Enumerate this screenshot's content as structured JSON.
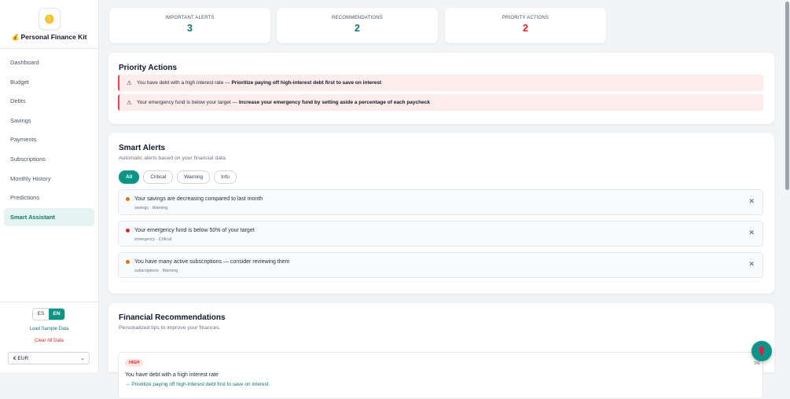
{
  "app": {
    "logo_icon": "🪙",
    "title_icon": "💰",
    "title": "Personal Finance Kit"
  },
  "nav": [
    {
      "label": "Dashboard",
      "active": false
    },
    {
      "label": "Budget",
      "active": false
    },
    {
      "label": "Debts",
      "active": false
    },
    {
      "label": "Savings",
      "active": false
    },
    {
      "label": "Payments",
      "active": false
    },
    {
      "label": "Subscriptions",
      "active": false
    },
    {
      "label": "Monthly History",
      "active": false
    },
    {
      "label": "Predictions",
      "active": false
    },
    {
      "label": "Smart Assistant",
      "active": true
    }
  ],
  "language": {
    "es": "ES",
    "en": "EN",
    "selected": "EN"
  },
  "sidebar_links": {
    "load_sample": "Load Sample Data",
    "clear_all": "Clear All Data"
  },
  "currency": {
    "selected": "€ EUR",
    "chevron": "⌄"
  },
  "stats": [
    {
      "label": "IMPORTANT ALERTS",
      "value": "3",
      "color": "#0f766e"
    },
    {
      "label": "RECOMMENDATIONS",
      "value": "2",
      "color": "#0f766e"
    },
    {
      "label": "PRIORITY ACTIONS",
      "value": "2",
      "color": "#dc2626"
    }
  ],
  "priority": {
    "title": "Priority Actions",
    "warn_icon": "⚠",
    "items": [
      {
        "text": "You have debt with a high interest rate — ",
        "action": "Prioritize paying off high-interest debt first to save on interest"
      },
      {
        "text": "Your emergency fund is below your target — ",
        "action": "Increase your emergency fund by setting aside a percentage of each paycheck"
      }
    ]
  },
  "alerts": {
    "title": "Smart Alerts",
    "subtitle": "Automatic alerts based on your financial data.",
    "filters": [
      "All",
      "Critical",
      "Warning",
      "Info"
    ],
    "active_filter": "All",
    "close_icon": "✕",
    "items": [
      {
        "message": "Your savings are decreasing compared to last month",
        "meta": "savings · Warning",
        "color": "#d97706"
      },
      {
        "message": "Your emergency fund is below 50% of your target",
        "meta": "emergency · Critical",
        "color": "#dc2626"
      },
      {
        "message": "You have many active subscriptions — consider reviewing them",
        "meta": "subscriptions · Warning",
        "color": "#d97706"
      }
    ]
  },
  "recommendations": {
    "title": "Financial Recommendations",
    "subtitle": "Personalized tips to improve your finances.",
    "items": [
      {
        "badge": "HIGH",
        "side": "DE",
        "title": "You have debt with a high interest rate",
        "tip": "→ Prioritize paying off high-interest debt first to save on interest"
      }
    ]
  },
  "colors": {
    "accent": "#0d9488",
    "critical": "#dc2626",
    "warning": "#d97706"
  }
}
